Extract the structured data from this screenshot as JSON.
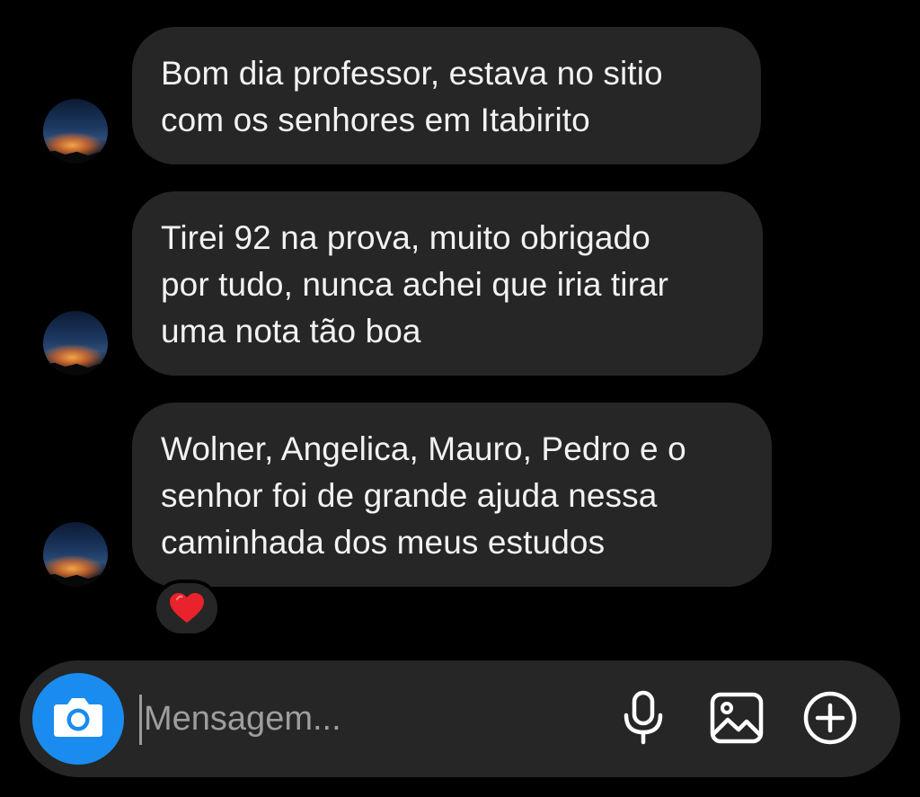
{
  "messages": [
    {
      "sender": "other",
      "text": "Bom dia professor, estava no sitio\ncom os senhores em Itabirito"
    },
    {
      "sender": "other",
      "text": "Tirei 92 na prova, muito obrigado\npor tudo, nunca achei que iria tirar\numa nota tão boa"
    },
    {
      "sender": "other",
      "text": "Wolner, Angelica, Mauro, Pedro e o\nsenhor foi de grande ajuda nessa\ncaminhada dos meus estudos",
      "reaction": "heart-icon"
    }
  ],
  "composer": {
    "placeholder": "Mensagem...",
    "value": "",
    "camera_icon": "camera-icon",
    "mic_icon": "microphone-icon",
    "gallery_icon": "image-gallery-icon",
    "plus_icon": "plus-circle-icon"
  },
  "colors": {
    "background": "#000000",
    "bubble": "#262626",
    "camera_button": "#1a8cf0",
    "reaction_heart": "#e8232b",
    "placeholder": "#9e9e9e"
  }
}
